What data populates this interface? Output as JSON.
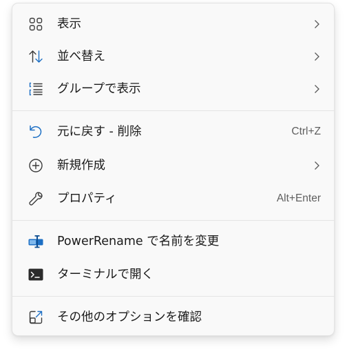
{
  "menu": {
    "items": [
      {
        "label": "表示",
        "icon": "grid-icon",
        "submenu": true
      },
      {
        "label": "並べ替え",
        "icon": "sort-arrows-icon",
        "submenu": true
      },
      {
        "label": "グループで表示",
        "icon": "group-list-icon",
        "submenu": true
      },
      {
        "label": "元に戻す - 削除",
        "icon": "undo-icon",
        "shortcut": "Ctrl+Z"
      },
      {
        "label": "新規作成",
        "icon": "plus-circle-icon",
        "submenu": true
      },
      {
        "label": "プロパティ",
        "icon": "wrench-icon",
        "shortcut": "Alt+Enter"
      },
      {
        "label": "PowerRename で名前を変更",
        "icon": "powerrename-icon"
      },
      {
        "label": "ターミナルで開く",
        "icon": "terminal-icon"
      },
      {
        "label": "その他のオプションを確認",
        "icon": "more-options-icon"
      }
    ]
  },
  "colors": {
    "accent": "#1d6fc4",
    "menu_background": "#f9f9f9",
    "text": "#1b1b1b",
    "shortcut_text": "#5f5f5f"
  }
}
